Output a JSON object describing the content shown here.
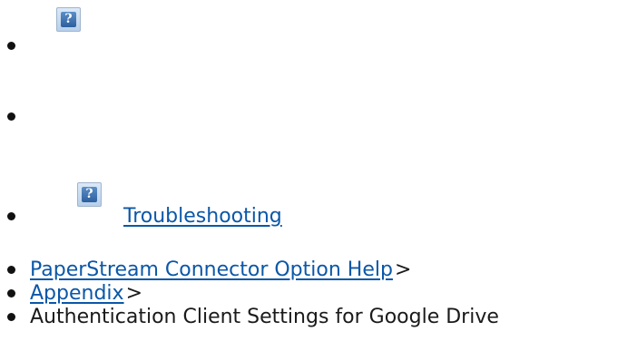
{
  "header_icon": {
    "icon": "help-question-icon",
    "glyph": "?"
  },
  "troubleshooting": {
    "icon": "help-question-icon",
    "glyph": "?",
    "label": "Troubleshooting"
  },
  "breadcrumb": {
    "items": [
      {
        "label": "PaperStream Connector Option Help",
        "separator": ">",
        "link": true
      },
      {
        "label": "Appendix",
        "separator": ">",
        "link": true
      },
      {
        "label": "Authentication Client Settings for Google Drive",
        "link": false
      }
    ]
  },
  "colors": {
    "link": "#0b57a8",
    "text": "#1a1a1a",
    "icon_bg": "#2d5f9e"
  }
}
